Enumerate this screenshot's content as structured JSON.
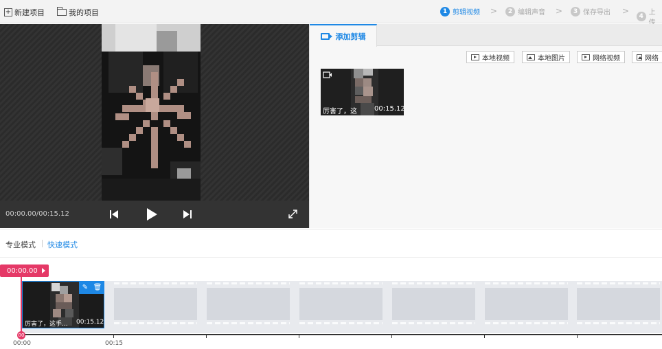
{
  "toolbar": {
    "new_project": "新建项目",
    "my_projects": "我的项目"
  },
  "steps": [
    {
      "num": "1",
      "label": "剪辑视频",
      "active": true
    },
    {
      "num": "2",
      "label": "编辑声音",
      "active": false
    },
    {
      "num": "3",
      "label": "保存导出",
      "active": false
    },
    {
      "num": "4",
      "label": "上传",
      "active": false
    }
  ],
  "player": {
    "timecode": "00:00.00/00:15.12"
  },
  "panel": {
    "tab_label": "添加剪辑",
    "source_buttons": [
      "本地视频",
      "本地图片",
      "网络视频",
      "网络"
    ],
    "clip": {
      "title": "厉害了，这",
      "duration": "00:15.12"
    }
  },
  "modes": {
    "pro": "专业模式",
    "fast": "快速模式"
  },
  "timeline": {
    "playhead_time": "00:00.00",
    "playhead_knob": "00",
    "clip": {
      "title": "厉害了，这手...",
      "duration": "00:15.12"
    },
    "ruler_labels": [
      "00:00",
      "00:15"
    ]
  },
  "colors": {
    "accent": "#1e88e5",
    "playhead": "#e53967"
  }
}
